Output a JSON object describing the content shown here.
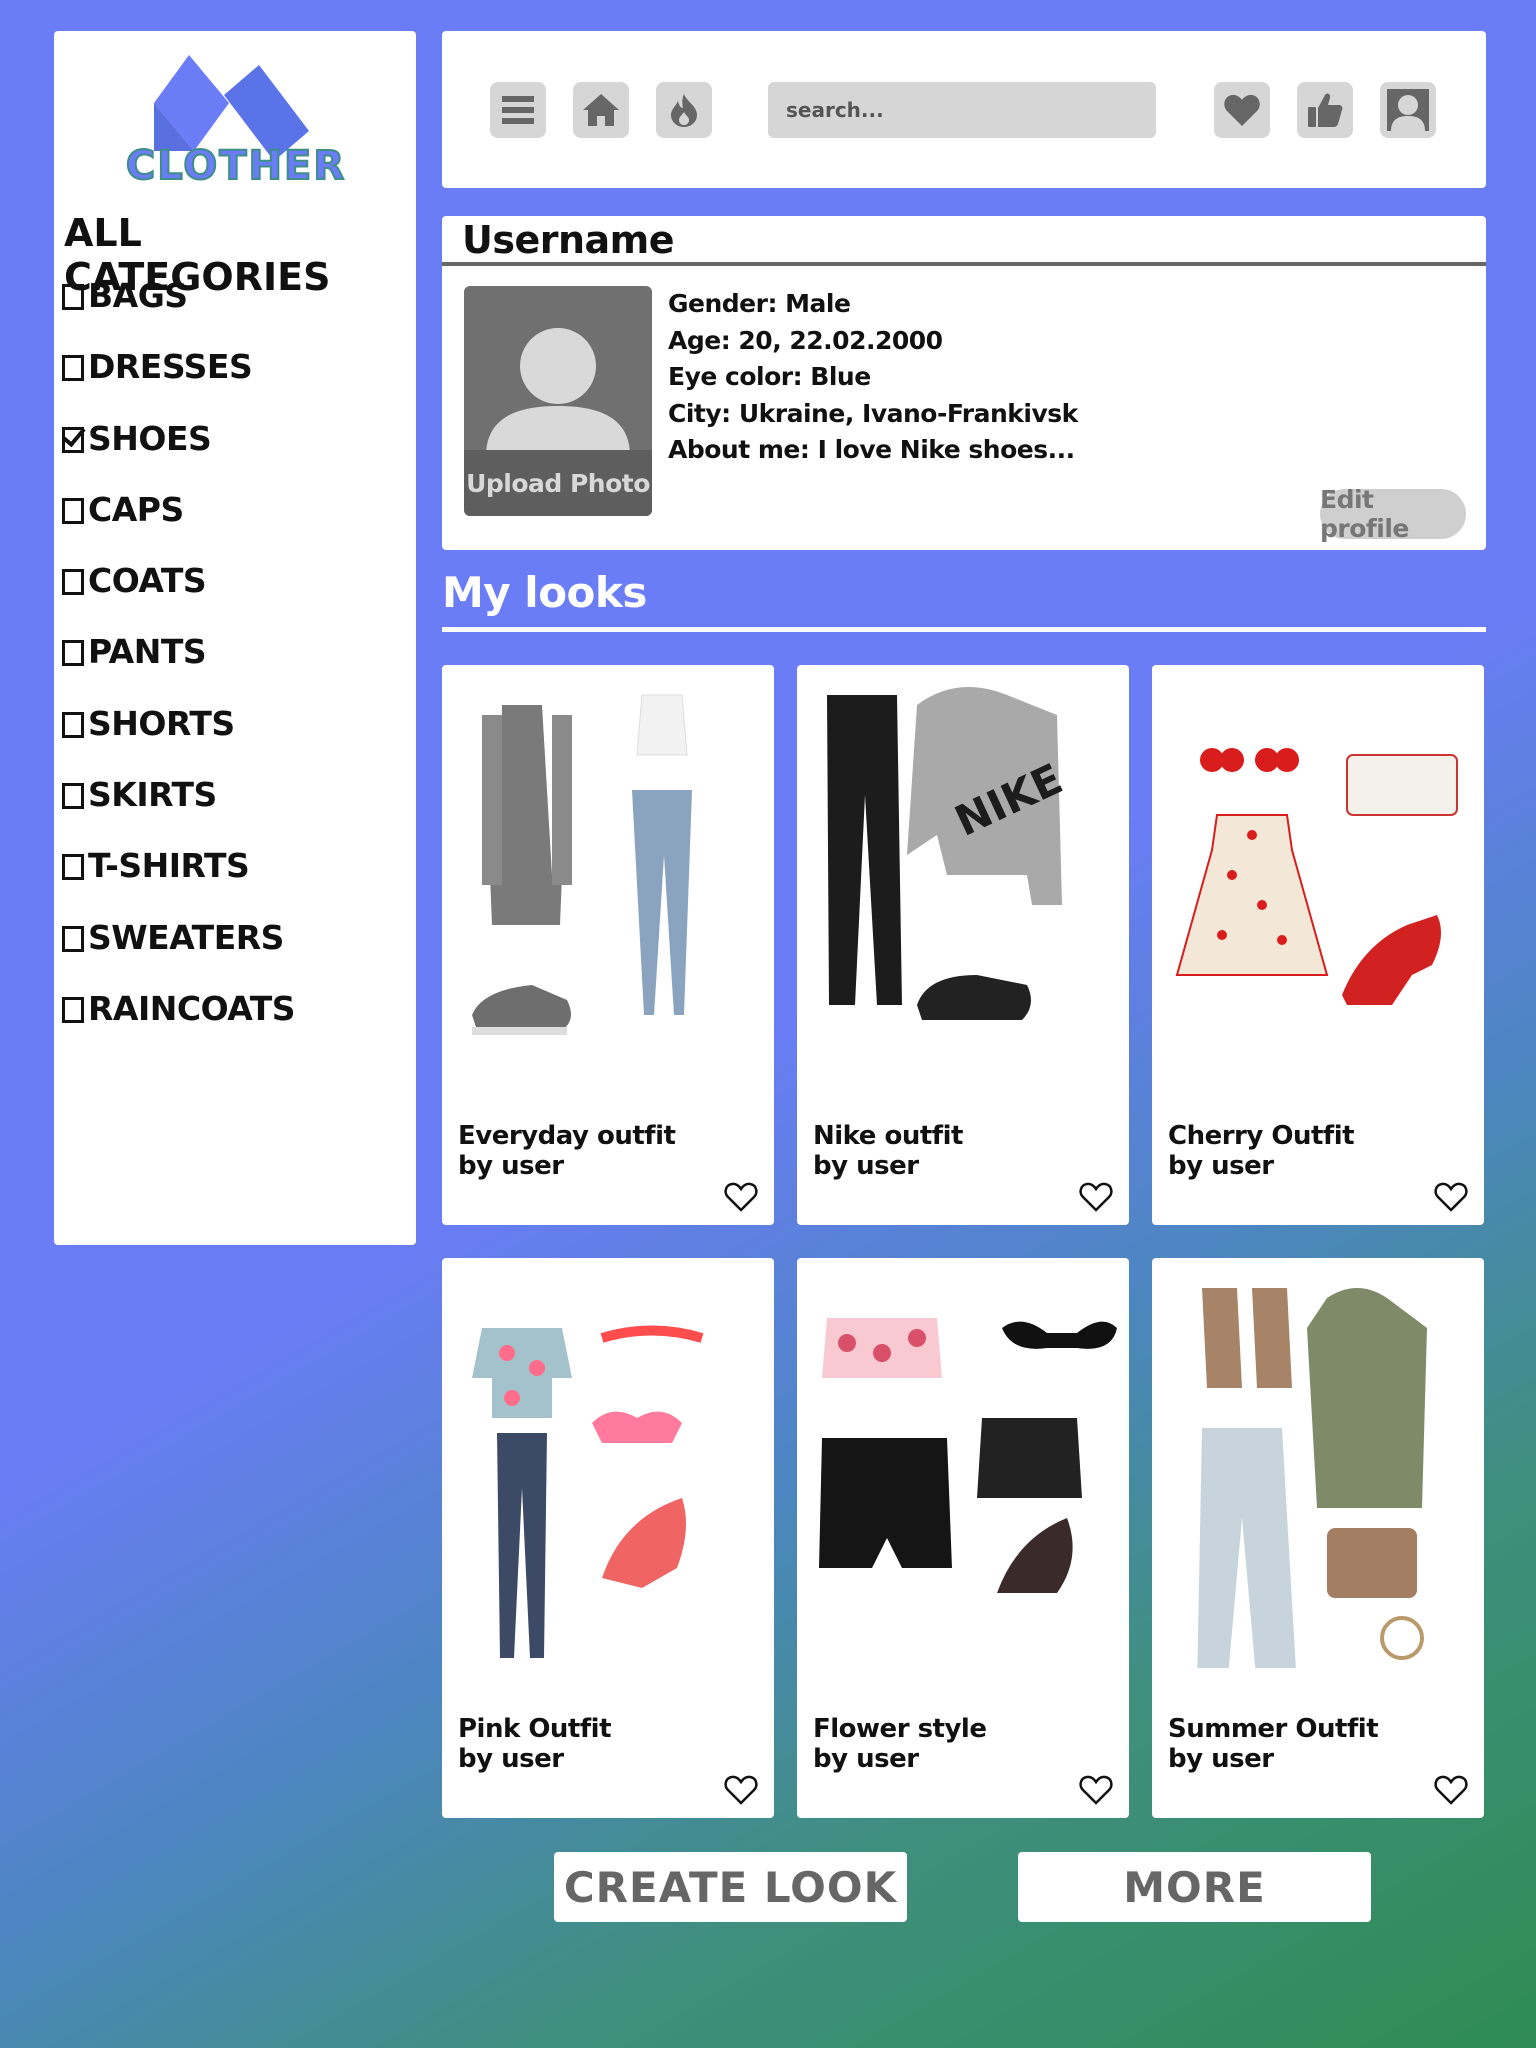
{
  "brand": {
    "name": "CLOTHER"
  },
  "sidebar": {
    "title": "ALL CATEGORIES",
    "items": [
      {
        "label": "BAGS",
        "checked": false
      },
      {
        "label": "DRESSES",
        "checked": false
      },
      {
        "label": "SHOES",
        "checked": true
      },
      {
        "label": "CAPS",
        "checked": false
      },
      {
        "label": "COATS",
        "checked": false
      },
      {
        "label": "PANTS",
        "checked": false
      },
      {
        "label": "SHORTS",
        "checked": false
      },
      {
        "label": "SKIRTS",
        "checked": false
      },
      {
        "label": "T-SHIRTS",
        "checked": false
      },
      {
        "label": "SWEATERS",
        "checked": false
      },
      {
        "label": "RAINCOATS",
        "checked": false
      }
    ]
  },
  "topbar": {
    "icons": [
      "menu-icon",
      "home-icon",
      "flame-icon",
      "heart-icon",
      "thumbs-up-icon",
      "user-icon"
    ],
    "search_placeholder": "search..."
  },
  "profile": {
    "username": "Username",
    "upload_label": "Upload Photo",
    "gender": "Gender: Male",
    "age": "Age: 20, 22.02.2000",
    "eye_color": "Eye color: Blue",
    "city": "City: Ukraine, Ivano-Frankivsk",
    "about": "About me: I love Nike shoes...",
    "edit_label": "Edit profile"
  },
  "looks": {
    "title": "My looks",
    "cards": [
      {
        "title": "Everyday outfit",
        "by": "by user"
      },
      {
        "title": "Nike outfit",
        "by": "by user"
      },
      {
        "title": "Cherry Outfit",
        "by": "by user"
      },
      {
        "title": "Pink Outfit",
        "by": "by user"
      },
      {
        "title": "Flower style",
        "by": "by user"
      },
      {
        "title": "Summer Outfit",
        "by": "by user"
      }
    ]
  },
  "actions": {
    "create_label": "CREATE LOOK",
    "more_label": "MORE"
  },
  "colors": {
    "background": "#6a7cf6",
    "accent_green": "#2f8c53",
    "button_gray": "#d6d6d6"
  }
}
